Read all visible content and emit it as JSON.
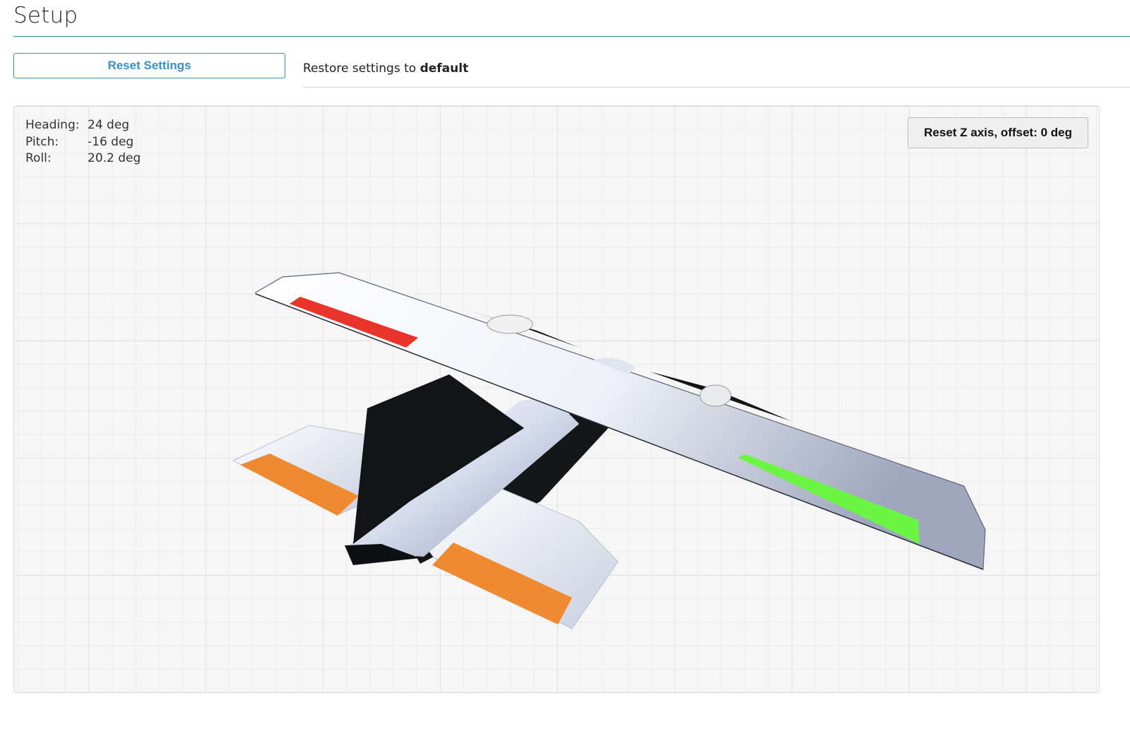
{
  "page": {
    "title": "Setup"
  },
  "settings": {
    "reset_label": "Reset Settings",
    "restore_prefix": "Restore settings to",
    "restore_emphasis": "default"
  },
  "viewer": {
    "heading_label": "Heading:",
    "heading_value": "24 deg",
    "pitch_label": "Pitch:",
    "pitch_value": "-16 deg",
    "roll_label": "Roll:",
    "roll_value": "20.2 deg",
    "reset_z_label": "Reset Z axis, offset: 0 deg",
    "model_colors": {
      "body": "#e8ecf4",
      "left_aileron": "#e8342a",
      "right_aileron": "#6cf542",
      "elevators": "#ee8a30",
      "tail_fin": "#121418"
    }
  }
}
